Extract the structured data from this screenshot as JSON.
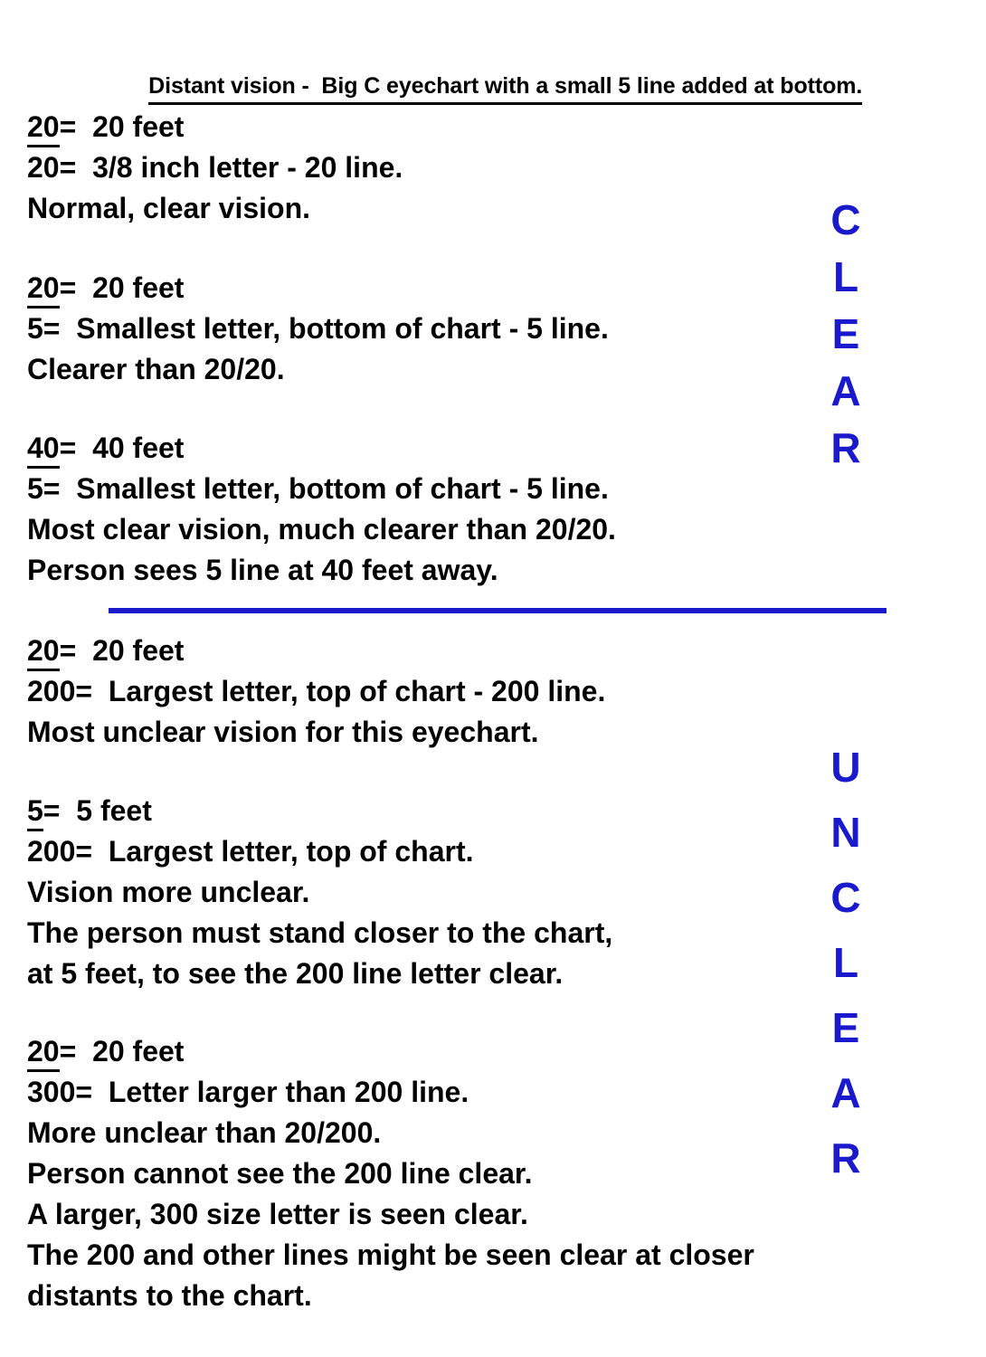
{
  "document": {
    "title": "Distant vision -  Big C eyechart with a small 5 line added at bottom.",
    "accent_color": "#1a1acc",
    "text_color": "#000000",
    "background_color": "#ffffff"
  },
  "blocks": [
    {
      "id": "block-20-20",
      "numerator": "20",
      "numerator_meaning": "=  20 feet",
      "denominator": "20",
      "denominator_meaning": "=  3/8 inch letter - 20 line.",
      "lines": [
        "Normal, clear vision."
      ]
    },
    {
      "id": "block-20-5",
      "numerator": "20",
      "numerator_meaning": "=  20 feet",
      "denominator": "5",
      "denominator_meaning": "=  Smallest letter, bottom of chart - 5 line.",
      "lines": [
        "Clearer than 20/20."
      ]
    },
    {
      "id": "block-40-5",
      "numerator": "40",
      "numerator_meaning": "=  40 feet",
      "denominator": "5",
      "denominator_meaning": "=  Smallest letter, bottom of chart - 5 line.",
      "lines": [
        "Most clear vision, much clearer than 20/20.",
        "Person sees 5 line at 40 feet away."
      ]
    },
    {
      "id": "block-20-200",
      "numerator": "20",
      "numerator_meaning": "=  20 feet",
      "denominator": "200",
      "denominator_meaning": "=  Largest letter, top of chart - 200 line.",
      "lines": [
        "Most unclear vision for this eyechart."
      ]
    },
    {
      "id": "block-5-200",
      "numerator": "5",
      "numerator_meaning": "=  5 feet",
      "denominator": "200",
      "denominator_meaning": "=  Largest letter, top of chart.",
      "lines": [
        "Vision more unclear.",
        "The person must stand closer to the chart,",
        "at 5 feet, to see the 200 line letter clear."
      ]
    },
    {
      "id": "block-20-300",
      "numerator": "20",
      "numerator_meaning": "=  20 feet",
      "denominator": "300",
      "denominator_meaning": "=  Letter larger than 200 line.",
      "lines": [
        "More unclear than 20/200.",
        "Person cannot see the 200 line clear.",
        "A larger, 300 size letter is seen clear.",
        "The 200 and other lines might be seen clear at closer",
        "distants to the chart."
      ]
    }
  ],
  "vertical_words": {
    "clear": {
      "text": "CLEAR",
      "letters": [
        "C",
        "L",
        "E",
        "A",
        "R"
      ]
    },
    "unclear": {
      "text": "UNCLEAR",
      "letters": [
        "U",
        "N",
        "C",
        "L",
        "E",
        "A",
        "R"
      ]
    }
  }
}
